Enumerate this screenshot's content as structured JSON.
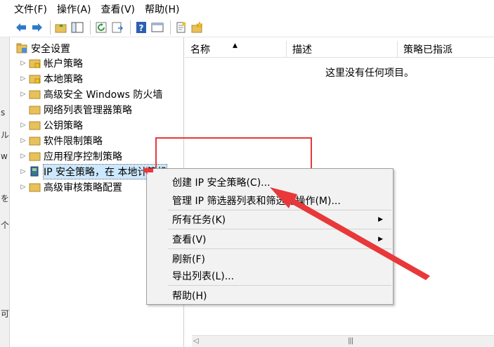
{
  "menu": [
    {
      "label": "文件(F)"
    },
    {
      "label": "操作(A)"
    },
    {
      "label": "查看(V)"
    },
    {
      "label": "帮助(H)"
    }
  ],
  "left_strip": [
    "s",
    "ル",
    "w",
    "を",
    "个",
    "可"
  ],
  "tree": {
    "root": "安全设置",
    "items": [
      {
        "label": "帐户策略"
      },
      {
        "label": "本地策略"
      },
      {
        "label": "高级安全 Windows 防火墙"
      },
      {
        "label": "网络列表管理器策略"
      },
      {
        "label": "公钥策略"
      },
      {
        "label": "软件限制策略"
      },
      {
        "label": "应用程序控制策略"
      },
      {
        "label": "IP 安全策略，在 本地计算机"
      },
      {
        "label": "高级审核策略配置"
      }
    ]
  },
  "list": {
    "columns": [
      "名称",
      "描述",
      "策略已指派"
    ],
    "empty_text": "这里没有任何项目。"
  },
  "context_menu": {
    "items": [
      {
        "label": "创建 IP 安全策略(C)..."
      },
      {
        "label": "管理 IP 筛选器列表和筛选器操作(M)..."
      },
      {
        "label": "所有任务(K)"
      },
      {
        "label": "查看(V)"
      },
      {
        "label": "刷新(F)"
      },
      {
        "label": "导出列表(L)..."
      },
      {
        "label": "帮助(H)"
      }
    ]
  },
  "colors": {
    "annotation_red": "#e8383a",
    "selection": "#cce8ff",
    "folder": "#e8c15a"
  }
}
